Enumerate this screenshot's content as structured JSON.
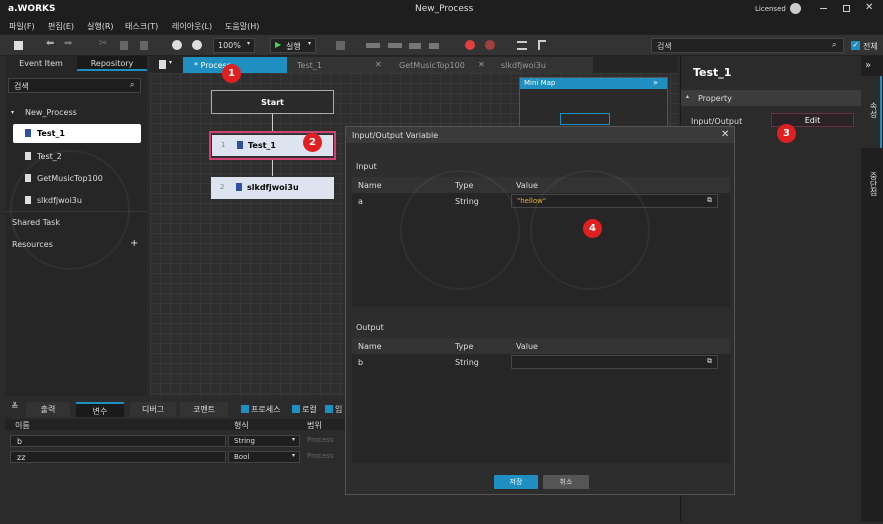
{
  "app": {
    "name": "a.WORKS",
    "title": "New_Process",
    "license": "Licensed"
  },
  "menu": [
    "파일(F)",
    "편집(E)",
    "실행(R)",
    "태스크(T)",
    "레이아웃(L)",
    "도움말(H)"
  ],
  "toolbar": {
    "zoom": "100%",
    "run": "실행",
    "search_placeholder": "검색",
    "check_all": "전체"
  },
  "left": {
    "tabs": [
      "Event Item",
      "Repository"
    ],
    "search_placeholder": "검색",
    "process": "New_Process",
    "items": [
      "Test_1",
      "Test_2",
      "GetMusicTop100",
      "slkdfjwoi3u"
    ],
    "shared": "Shared Task",
    "resources": "Resources"
  },
  "doctabs": [
    "* Process",
    "Test_1",
    "GetMusicTop100",
    "slkdfjwoi3u"
  ],
  "canvas": {
    "start": "Start",
    "nodes": [
      {
        "num": "1",
        "label": "Test_1"
      },
      {
        "num": "2",
        "label": "slkdfjwoi3u"
      }
    ],
    "minimap": "Mini Map"
  },
  "right": {
    "title": "Test_1",
    "section": "Property",
    "prop_label": "Input/Output",
    "edit": "Edit",
    "side_tabs": [
      "속성",
      "중단점"
    ]
  },
  "bottom": {
    "tabs": [
      "출력",
      "변수",
      "디버그",
      "코멘트"
    ],
    "checks": [
      "프로세스",
      "로컬",
      "임"
    ],
    "headers": [
      "이름",
      "형식",
      "범위"
    ],
    "rows": [
      {
        "name": "b",
        "type": "String",
        "scope": "Process"
      },
      {
        "name": "zz",
        "type": "Bool",
        "scope": "Process"
      }
    ]
  },
  "dialog": {
    "title": "Input/Output Variable",
    "input_label": "Input",
    "output_label": "Output",
    "headers": [
      "Name",
      "Type",
      "Value"
    ],
    "input_rows": [
      {
        "name": "a",
        "type": "String",
        "value": "\"hellow\""
      }
    ],
    "output_rows": [
      {
        "name": "b",
        "type": "String",
        "value": ""
      }
    ],
    "save": "저장",
    "cancel": "취소"
  },
  "badges": [
    "1",
    "2",
    "3",
    "4"
  ],
  "colors": {
    "accent": "#1e8fc0",
    "badge": "#e02020",
    "selected_node": "#d04070"
  }
}
